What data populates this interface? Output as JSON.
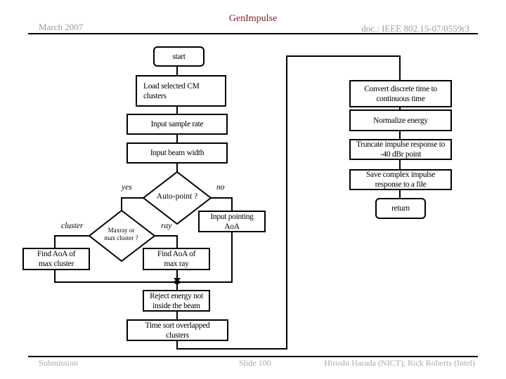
{
  "header": {
    "title": "GenImpulse",
    "date": "March 2007",
    "doc_id": "doc.: IEEE 802.15-07/0559r3"
  },
  "flowchart": {
    "start": "start",
    "load_clusters": "Load selected CM clusters",
    "input_sample_rate": "Input sample rate",
    "input_beam_width": "Input beam width",
    "auto_point_decision": "Auto-point ?",
    "yes_label": "yes",
    "no_label": "no",
    "max_decision_line1": "Maxray or",
    "max_decision_line2": "max cluster ?",
    "cluster_label": "cluster",
    "ray_label": "ray",
    "input_pointing": "Input pointing AoA",
    "find_aoa_cluster": "Find AoA of max cluster",
    "find_aoa_ray": "Find AoA of max ray",
    "reject_energy": "Reject energy not inside the beam",
    "time_sort": "Time sort overlapped clusters",
    "convert_time": "Convert discrete time to continuous time",
    "normalize_energy": "Normalize energy",
    "truncate": "Truncate impulse response to -40 dBr point",
    "save_file": "Save complex impulse response to a file",
    "return": "return"
  },
  "footer": {
    "left": "Submission",
    "center": "Slide 100",
    "right": "Hiroshi Harada (NICT), Rick Roberts (Intel)"
  }
}
